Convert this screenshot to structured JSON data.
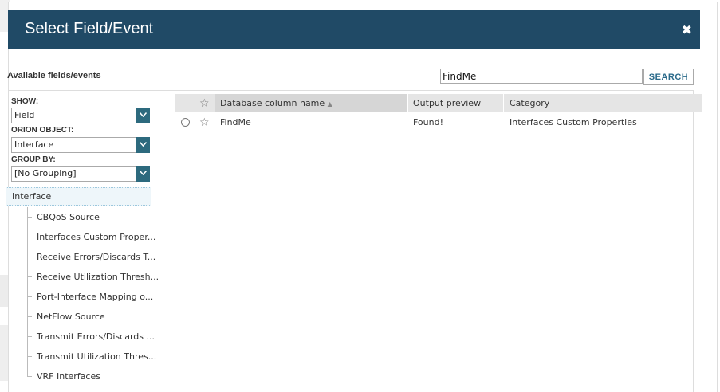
{
  "dialog": {
    "title": "Select Field/Event",
    "close_glyph": "✖"
  },
  "search": {
    "panel_label": "Available fields/events",
    "value": "FindMe",
    "button_label": "SEARCH"
  },
  "filters": {
    "show": {
      "label": "SHOW:",
      "value": "Field"
    },
    "orion_object": {
      "label": "ORION OBJECT:",
      "value": "Interface"
    },
    "group_by": {
      "label": "GROUP BY:",
      "value": "[No Grouping]"
    }
  },
  "tree": {
    "root": "Interface",
    "items": [
      "CBQoS Source",
      "Interfaces Custom Proper...",
      "Receive Errors/Discards T...",
      "Receive Utilization Thresh...",
      "Port-Interface Mapping o...",
      "NetFlow Source",
      "Transmit Errors/Discards ...",
      "Transmit Utilization Thres...",
      "VRF Interfaces"
    ]
  },
  "grid": {
    "columns": {
      "name": "Database column name",
      "preview": "Output preview",
      "category": "Category"
    },
    "sort_glyph": "▲",
    "star_glyph": "☆",
    "rows": [
      {
        "name": "FindMe",
        "preview": "Found!",
        "category": "Interfaces Custom Properties"
      }
    ]
  }
}
